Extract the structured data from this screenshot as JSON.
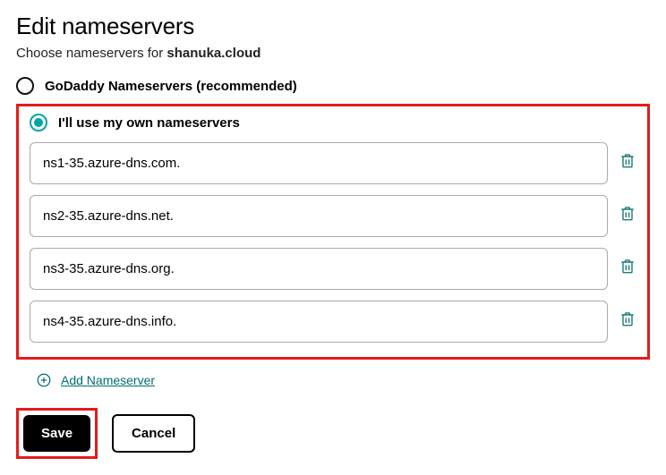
{
  "title": "Edit nameservers",
  "subtitle_prefix": "Choose nameservers for ",
  "domain": "shanuka.cloud",
  "options": {
    "godaddy": "GoDaddy Nameservers (recommended)",
    "own": "I'll use my own nameservers"
  },
  "selected": "own",
  "nameservers": [
    "ns1-35.azure-dns.com.",
    "ns2-35.azure-dns.net.",
    "ns3-35.azure-dns.org.",
    "ns4-35.azure-dns.info."
  ],
  "add_label": "Add Nameserver",
  "buttons": {
    "save": "Save",
    "cancel": "Cancel"
  },
  "colors": {
    "accent": "#00a4a6",
    "highlight": "#e41b1b",
    "link": "#006e6e"
  }
}
